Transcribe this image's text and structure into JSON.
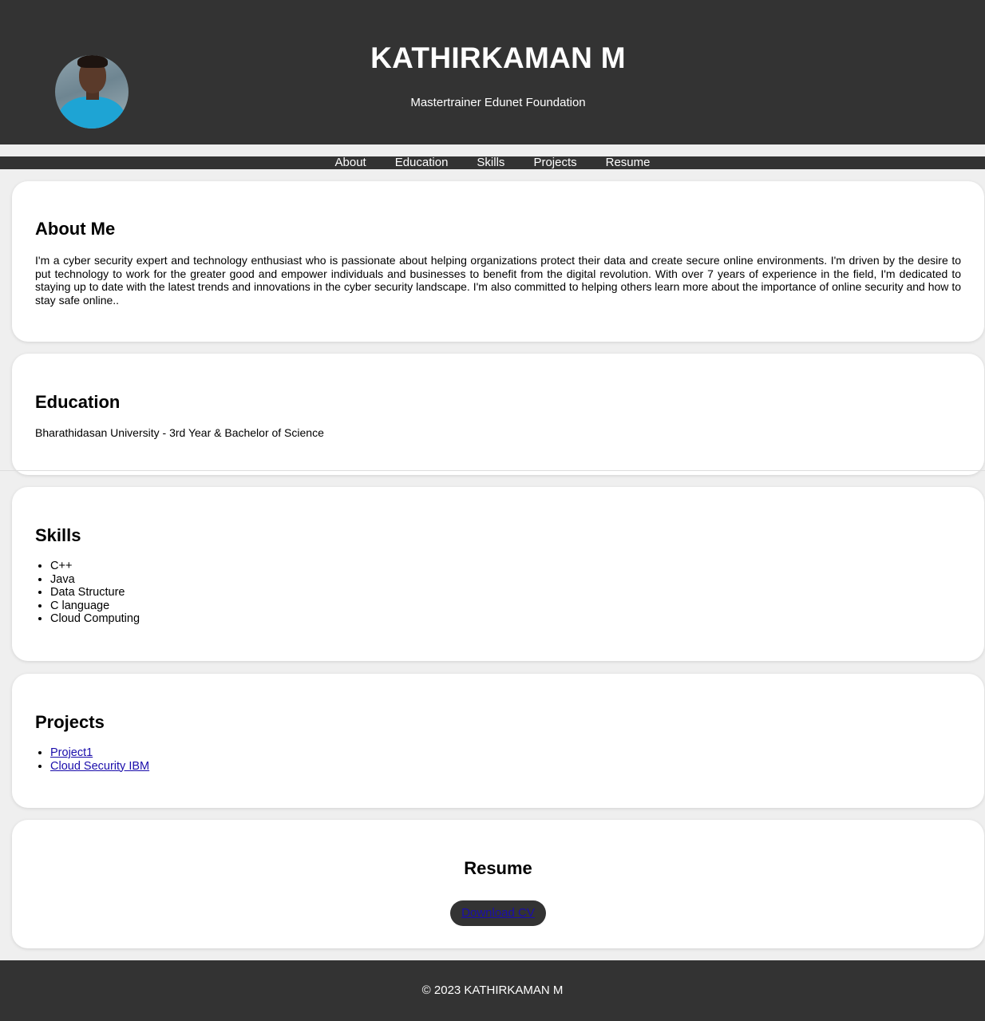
{
  "header": {
    "name": "KATHIRKAMAN M",
    "subtitle": "Mastertrainer Edunet Foundation"
  },
  "nav": {
    "items": [
      "About",
      "Education",
      "Skills",
      "Projects",
      "Resume"
    ]
  },
  "about": {
    "heading": "About Me",
    "text": "I'm a cyber security expert and technology enthusiast who is passionate about helping organizations protect their data and create secure online environments. I'm driven by the desire to put technology to work for the greater good and empower individuals and businesses to benefit from the digital revolution. With over 7 years of experience in the field, I'm dedicated to staying up to date with the latest trends and innovations in the cyber security landscape. I'm also committed to helping others learn more about the importance of online security and how to stay safe online.."
  },
  "education": {
    "heading": "Education",
    "text": "Bharathidasan University - 3rd Year & Bachelor of Science"
  },
  "skills": {
    "heading": "Skills",
    "items": [
      "C++",
      "Java",
      "Data Structure",
      "C language",
      "Cloud Computing"
    ]
  },
  "projects": {
    "heading": "Projects",
    "items": [
      "Project1",
      "Cloud Security IBM"
    ]
  },
  "resume": {
    "heading": "Resume",
    "button_label": "Download CV"
  },
  "footer": {
    "text": "© 2023 KATHIRKAMAN M"
  },
  "colors": {
    "dark": "#333333",
    "background": "#efefef",
    "link": "#1a0dab"
  }
}
